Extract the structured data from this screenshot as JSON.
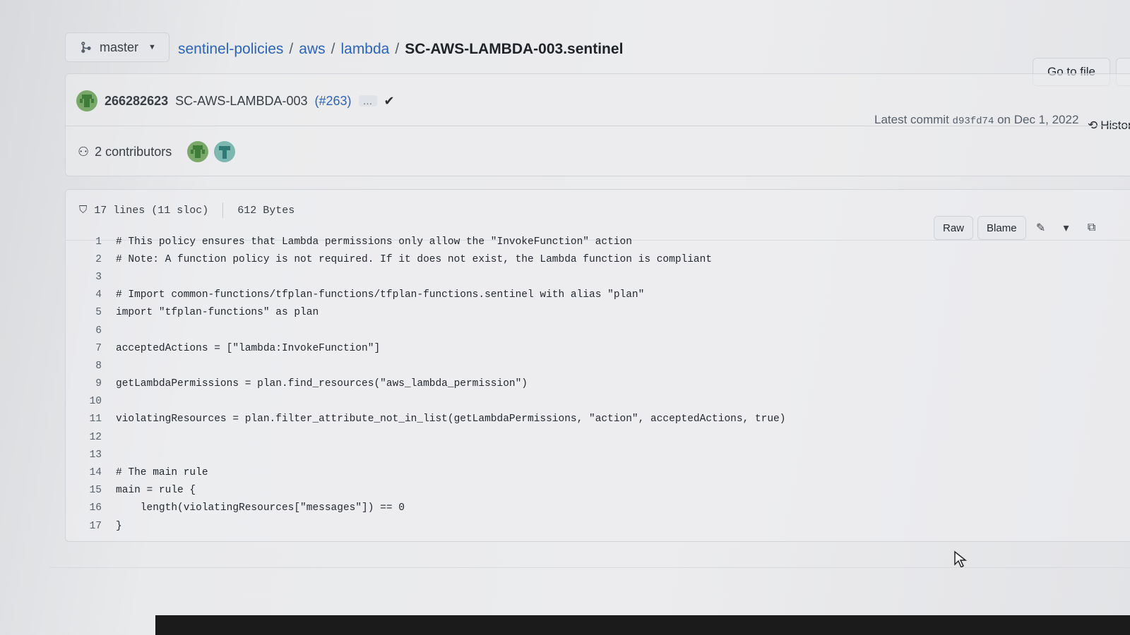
{
  "branch": {
    "name": "master",
    "icon": "git-branch-icon"
  },
  "breadcrumb": {
    "repo": "sentinel-policies",
    "sep": "/",
    "dir1": "aws",
    "dir2": "lambda",
    "file": "SC-AWS-LAMBDA-003.sentinel"
  },
  "toolbar": {
    "goto_file": "Go to file"
  },
  "commit": {
    "id": "266282623",
    "message": "SC-AWS-LAMBDA-003",
    "pr": "(#263)",
    "ellipsis": "…",
    "latest_label": "Latest commit",
    "sha": "d93fd74",
    "date_text": "on Dec 1, 2022",
    "history_label": "History"
  },
  "contributors": {
    "label": "2 contributors"
  },
  "file": {
    "lines_info": "17 lines (11 sloc)",
    "size": "612 Bytes",
    "raw": "Raw",
    "blame": "Blame"
  },
  "code": [
    {
      "n": "1",
      "text": "# This policy ensures that Lambda permissions only allow the \"InvokeFunction\" action"
    },
    {
      "n": "2",
      "text": "# Note: A function policy is not required. If it does not exist, the Lambda function is compliant"
    },
    {
      "n": "3",
      "text": ""
    },
    {
      "n": "4",
      "text": "# Import common-functions/tfplan-functions/tfplan-functions.sentinel with alias \"plan\""
    },
    {
      "n": "5",
      "text": "import \"tfplan-functions\" as plan"
    },
    {
      "n": "6",
      "text": ""
    },
    {
      "n": "7",
      "text": "acceptedActions = [\"lambda:InvokeFunction\"]"
    },
    {
      "n": "8",
      "text": ""
    },
    {
      "n": "9",
      "text": "getLambdaPermissions = plan.find_resources(\"aws_lambda_permission\")"
    },
    {
      "n": "10",
      "text": ""
    },
    {
      "n": "11",
      "text": "violatingResources = plan.filter_attribute_not_in_list(getLambdaPermissions, \"action\", acceptedActions, true)"
    },
    {
      "n": "12",
      "text": ""
    },
    {
      "n": "13",
      "text": ""
    },
    {
      "n": "14",
      "text": "# The main rule"
    },
    {
      "n": "15",
      "text": "main = rule {"
    },
    {
      "n": "16",
      "text": "    length(violatingResources[\"messages\"]) == 0"
    },
    {
      "n": "17",
      "text": "}"
    }
  ]
}
